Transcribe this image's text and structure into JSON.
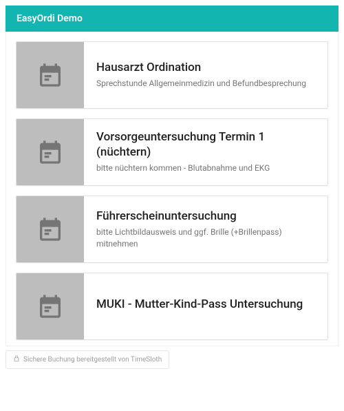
{
  "header": {
    "title": "EasyOrdi Demo"
  },
  "services": [
    {
      "title": "Hausarzt Ordination",
      "desc": "Sprechstunde Allgemeinmedizin und Befundbespre­chung"
    },
    {
      "title": "Vorsorgeuntersuchung Termin 1 (nüchtern)",
      "desc": "bitte nüchtern kommen - Blutabnahme und EKG"
    },
    {
      "title": "Führerscheinuntersuchung",
      "desc": "bitte Lichtbildausweis und ggf. Brille (+Brillenpass) mitnehmen"
    },
    {
      "title": "MUKI - Mutter-Kind-Pass Untersu­chung",
      "desc": ""
    }
  ],
  "footer": {
    "text": "Sichere Buchung bereitgestellt von TimeSloth"
  }
}
